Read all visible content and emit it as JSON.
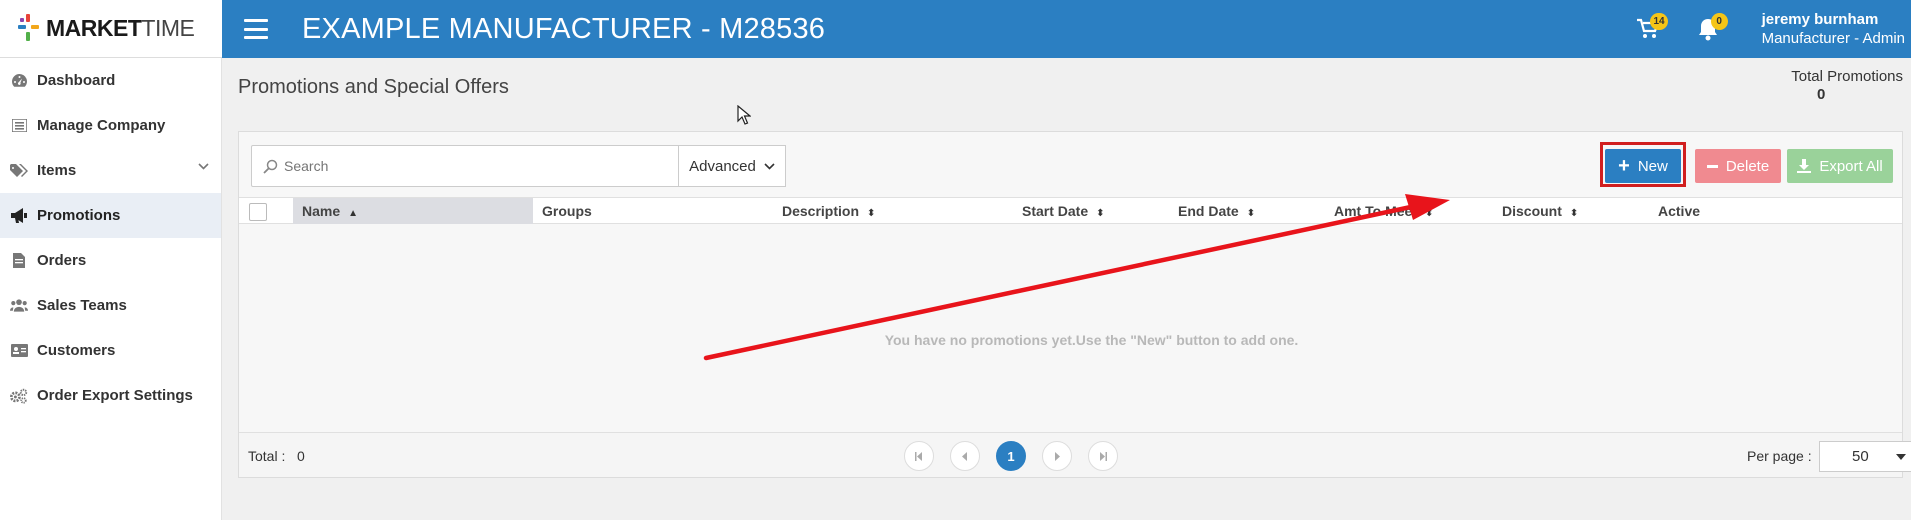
{
  "app": {
    "logo_main": "MARKET",
    "logo_light": "TIME",
    "company_title": "EXAMPLE MANUFACTURER - M28536",
    "cart_count": "14",
    "notification_count": "0",
    "user_name": "jeremy burnham",
    "user_role": "Manufacturer - Admin",
    "accent_color": "#2b7fc2"
  },
  "sidebar": {
    "items": [
      {
        "label": "Dashboard",
        "icon": "speedometer-icon"
      },
      {
        "label": "Manage Company",
        "icon": "list-icon"
      },
      {
        "label": "Items",
        "icon": "tags-icon"
      },
      {
        "label": "Promotions",
        "icon": "megaphone-icon"
      },
      {
        "label": "Orders",
        "icon": "document-icon"
      },
      {
        "label": "Sales Teams",
        "icon": "users-icon"
      },
      {
        "label": "Customers",
        "icon": "id-card-icon"
      },
      {
        "label": "Order Export Settings",
        "icon": "cogs-icon"
      }
    ]
  },
  "main": {
    "page_title": "Promotions and Special Offers",
    "total_label": "Total Promotions",
    "total_value": "0",
    "search_placeholder": "Search",
    "advanced_label": "Advanced",
    "new_label": "New",
    "delete_label": "Delete",
    "export_label": "Export All",
    "columns": [
      "Name",
      "Groups",
      "Description",
      "Start Date",
      "End Date",
      "Amt To Meet",
      "Discount",
      "Active"
    ],
    "empty_message": "You have no promotions yet.Use the \"New\" button to add one.",
    "footer_total_label": "Total :",
    "footer_total_value": "0",
    "current_page": "1",
    "per_page_label": "Per page :",
    "per_page_value": "50"
  }
}
